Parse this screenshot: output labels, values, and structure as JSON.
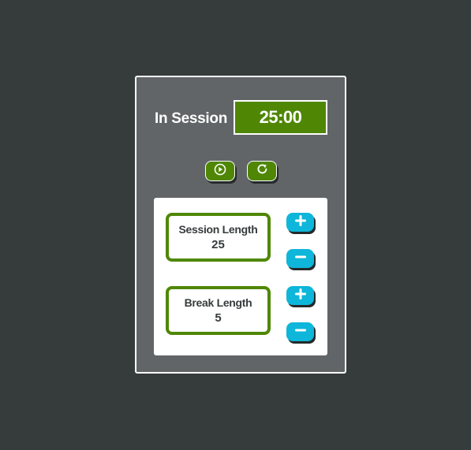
{
  "status": {
    "label": "In Session",
    "timer": "25:00"
  },
  "controls": {
    "play_icon": "play-circle-icon",
    "reset_icon": "refresh-icon"
  },
  "session": {
    "title": "Session Length",
    "value": "25",
    "increment_icon": "plus-icon",
    "decrement_icon": "minus-icon"
  },
  "break": {
    "title": "Break Length",
    "value": "5",
    "increment_icon": "plus-icon",
    "decrement_icon": "minus-icon"
  },
  "colors": {
    "background": "#363b3c",
    "card": "#616568",
    "accent_green": "#4f8705",
    "accent_cyan": "#0eb6da",
    "text_dark": "#363b3c"
  }
}
